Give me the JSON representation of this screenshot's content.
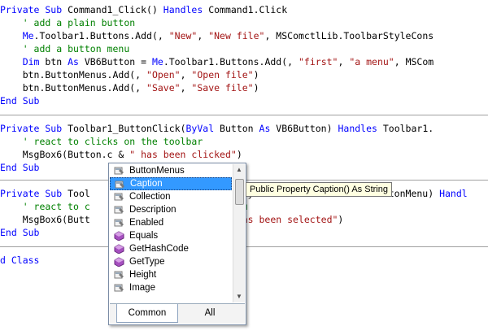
{
  "code": {
    "block1": [
      [
        {
          "c": "kw",
          "t": "Private Sub "
        },
        {
          "c": "tx",
          "t": "Command1_Click() "
        },
        {
          "c": "kw",
          "t": "Handles "
        },
        {
          "c": "tx",
          "t": "Command1.Click"
        }
      ],
      [
        {
          "c": "cm",
          "t": "    ' add a plain button"
        }
      ],
      [
        {
          "c": "kw",
          "t": "    Me"
        },
        {
          "c": "tx",
          "t": ".Toolbar1.Buttons.Add(, "
        },
        {
          "c": "st",
          "t": "\"New\""
        },
        {
          "c": "tx",
          "t": ", "
        },
        {
          "c": "st",
          "t": "\"New file\""
        },
        {
          "c": "tx",
          "t": ", MSComctlLib.ToolbarStyleCons"
        }
      ],
      [
        {
          "c": "cm",
          "t": "    ' add a button menu"
        }
      ],
      [
        {
          "c": "kw",
          "t": "    Dim "
        },
        {
          "c": "tx",
          "t": "btn "
        },
        {
          "c": "kw",
          "t": "As "
        },
        {
          "c": "tx",
          "t": "VB6Button = "
        },
        {
          "c": "kw",
          "t": "Me"
        },
        {
          "c": "tx",
          "t": ".Toolbar1.Buttons.Add(, "
        },
        {
          "c": "st",
          "t": "\"first\""
        },
        {
          "c": "tx",
          "t": ", "
        },
        {
          "c": "st",
          "t": "\"a menu\""
        },
        {
          "c": "tx",
          "t": ", MSCom"
        }
      ],
      [
        {
          "c": "tx",
          "t": "    btn.ButtonMenus.Add(, "
        },
        {
          "c": "st",
          "t": "\"Open\""
        },
        {
          "c": "tx",
          "t": ", "
        },
        {
          "c": "st",
          "t": "\"Open file\""
        },
        {
          "c": "tx",
          "t": ")"
        }
      ],
      [
        {
          "c": "tx",
          "t": "    btn.ButtonMenus.Add(, "
        },
        {
          "c": "st",
          "t": "\"Save\""
        },
        {
          "c": "tx",
          "t": ", "
        },
        {
          "c": "st",
          "t": "\"Save file\""
        },
        {
          "c": "tx",
          "t": ")"
        }
      ],
      [
        {
          "c": "kw",
          "t": "End Sub"
        }
      ]
    ],
    "block2": [
      [
        {
          "c": "kw",
          "t": "Private Sub "
        },
        {
          "c": "tx",
          "t": "Toolbar1_ButtonClick("
        },
        {
          "c": "kw",
          "t": "ByVal "
        },
        {
          "c": "tx",
          "t": "Button "
        },
        {
          "c": "kw",
          "t": "As "
        },
        {
          "c": "tx",
          "t": "VB6Button) "
        },
        {
          "c": "kw",
          "t": "Handles "
        },
        {
          "c": "tx",
          "t": "Toolbar1."
        }
      ],
      [
        {
          "c": "cm",
          "t": "    ' react to clicks on the toolbar"
        }
      ],
      [
        {
          "c": "tx",
          "t": "    MsgBox6(Button.c & "
        },
        {
          "c": "st",
          "t": "\" has been clicked\""
        },
        {
          "c": "tx",
          "t": ")"
        }
      ],
      [
        {
          "c": "kw",
          "t": "End Sub"
        }
      ]
    ],
    "block3": [
      [
        {
          "c": "kw",
          "t": "Private Sub "
        },
        {
          "c": "tx",
          "t": "Tool"
        },
        {
          "c": "tx",
          "t": "                           ByVal ButtonMenu As VB6ButtonMenu) "
        },
        {
          "c": "kw",
          "t": "Handl"
        }
      ],
      [
        {
          "c": "cm",
          "t": "    ' react to c                          nu"
        }
      ],
      [
        {
          "c": "tx",
          "t": "    MsgBox6(Butt"
        },
        {
          "c": "st",
          "t": "                           as been selected\""
        },
        {
          "c": "tx",
          "t": ")"
        }
      ],
      [
        {
          "c": "kw",
          "t": "End Sub"
        }
      ]
    ],
    "block4": [
      [
        {
          "c": "kw",
          "t": "d Class"
        }
      ]
    ]
  },
  "intellisense": {
    "items": [
      {
        "label": "ButtonMenus",
        "icon": "property-icon"
      },
      {
        "label": "Caption",
        "icon": "property-icon",
        "selected": true
      },
      {
        "label": "Collection",
        "icon": "property-icon"
      },
      {
        "label": "Description",
        "icon": "property-icon"
      },
      {
        "label": "Enabled",
        "icon": "property-icon"
      },
      {
        "label": "Equals",
        "icon": "method-icon"
      },
      {
        "label": "GetHashCode",
        "icon": "method-icon"
      },
      {
        "label": "GetType",
        "icon": "method-icon"
      },
      {
        "label": "Height",
        "icon": "property-icon"
      },
      {
        "label": "Image",
        "icon": "property-icon"
      }
    ],
    "tabs": {
      "common": "Common",
      "all": "All"
    },
    "tooltip": "Public Property Caption() As String"
  }
}
